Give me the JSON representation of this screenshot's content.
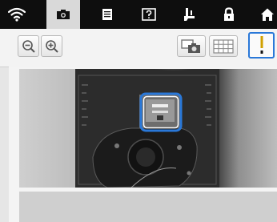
{
  "top_tabs": [
    {
      "icon": "wifi-icon",
      "active": false
    },
    {
      "icon": "camera-icon",
      "active": true
    },
    {
      "icon": "document-icon",
      "active": false
    },
    {
      "icon": "help-icon",
      "active": false
    },
    {
      "icon": "sewing-foot-icon",
      "active": false
    },
    {
      "icon": "lock-icon",
      "active": false
    },
    {
      "icon": "home-icon",
      "active": false
    }
  ],
  "toolbar": {
    "zoom_out_icon": "zoom-out-icon",
    "zoom_in_icon": "zoom-in-icon",
    "camera_capture_icon": "camera-capture-icon",
    "grid_icon": "grid-icon",
    "needle_position_icon": "needle-position-icon"
  },
  "colors": {
    "accent": "#2a78d8",
    "needle_marker": "#d0a000",
    "topbar": "#0e0e0e"
  }
}
